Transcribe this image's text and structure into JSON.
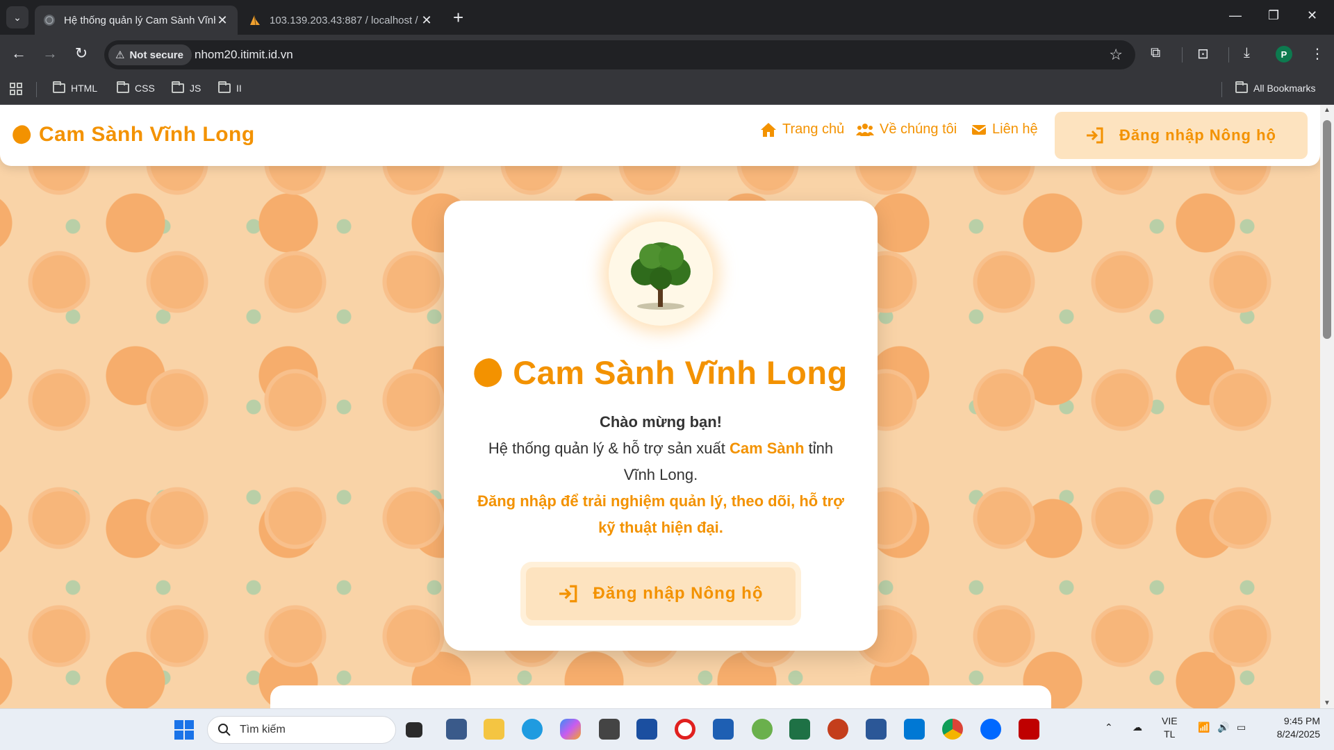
{
  "browser": {
    "tabs": [
      {
        "title": "Hệ thống quản lý Cam Sành Vĩnh Long",
        "active": true
      },
      {
        "title": "103.139.203.43:887 / localhost / ",
        "active": false
      }
    ],
    "address": {
      "security_label": "Not secure",
      "url": "nhom20.itimit.id.vn"
    },
    "profile_initial": "P",
    "bookmarks": [
      "HTML",
      "CSS",
      "JS",
      "II"
    ],
    "all_bookmarks_label": "All Bookmarks"
  },
  "site": {
    "brand": "Cam Sành Vĩnh Long",
    "nav": {
      "home": "Trang chủ",
      "about": "Về chúng tôi",
      "contact": "Liên hệ"
    },
    "header_login": "Đăng nhập Nông hộ",
    "card": {
      "title": "Cam Sành Vĩnh Long",
      "greeting": "Chào mừng bạn!",
      "line1_pre": "Hệ thống quản lý & hỗ trợ sản xuất ",
      "line1_hl": "Cam Sành",
      "line1_post": " tỉnh Vĩnh Long.",
      "cta": "Đăng nhập để trải nghiệm quản lý, theo dõi, hỗ trợ kỹ thuật hiện đại.",
      "login_button": "Đăng nhập Nông hộ"
    },
    "accent_color": "#f39200"
  },
  "taskbar": {
    "search_placeholder": "Tìm kiếm",
    "lang": {
      "line1": "VIE",
      "line2": "TL"
    },
    "time": "9:45 PM",
    "date": "8/24/2025"
  }
}
